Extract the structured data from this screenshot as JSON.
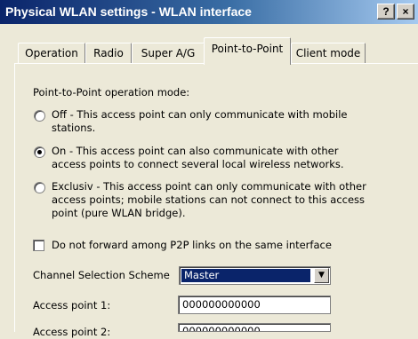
{
  "window": {
    "title": "Physical WLAN settings - WLAN interface",
    "help_button": "?",
    "close_button": "×"
  },
  "tabs": [
    {
      "label": "Operation",
      "active": false
    },
    {
      "label": "Radio",
      "active": false
    },
    {
      "label": "Super A/G",
      "active": false
    },
    {
      "label": "Point-to-Point",
      "active": true
    },
    {
      "label": "Client mode",
      "active": false
    }
  ],
  "p2p": {
    "mode_heading": "Point-to-Point operation mode:",
    "options": [
      {
        "line1": "Off - This access point can only communicate with mobile",
        "line2": "stations.",
        "selected": false
      },
      {
        "line1": "On - This access point can also communicate with other",
        "line2": "access points to connect several local wireless networks.",
        "selected": true
      },
      {
        "line1": "Exclusiv - This access point can only communicate with other",
        "line2": "access points; mobile stations can not connect to this access",
        "line3": "point (pure WLAN bridge).",
        "selected": false
      }
    ],
    "no_forward_label": "Do not forward among P2P links on the same interface",
    "no_forward_checked": false,
    "channel_label": "Channel Selection Scheme",
    "channel_value": "Master",
    "access_point_1_label": "Access point 1:",
    "access_point_1_value": "000000000000",
    "access_point_2_label": "Access point 2:",
    "access_point_2_value": "000000000000"
  }
}
